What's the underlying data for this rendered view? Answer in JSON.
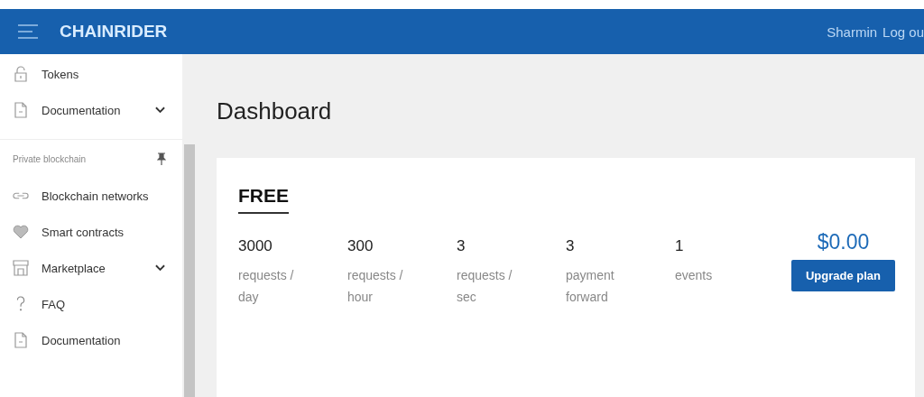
{
  "header": {
    "title": "CHAINRIDER",
    "user": "Sharmin",
    "logout": "Log ou"
  },
  "sidebar": {
    "top_items": [
      {
        "label": "Tokens",
        "expandable": false
      },
      {
        "label": "Documentation",
        "expandable": true
      }
    ],
    "section": {
      "title": "Private blockchain",
      "items": [
        {
          "label": "Blockchain networks",
          "expandable": false
        },
        {
          "label": "Smart contracts",
          "expandable": false
        },
        {
          "label": "Marketplace",
          "expandable": true
        },
        {
          "label": "FAQ",
          "expandable": false
        },
        {
          "label": "Documentation",
          "expandable": false
        }
      ]
    }
  },
  "page": {
    "title": "Dashboard"
  },
  "plan": {
    "name": "FREE",
    "stats": [
      {
        "value": "3000",
        "label": "requests / day"
      },
      {
        "value": "300",
        "label": "requests / hour"
      },
      {
        "value": "3",
        "label": "requests / sec"
      },
      {
        "value": "3",
        "label": "payment forward"
      },
      {
        "value": "1",
        "label": "events"
      }
    ],
    "price": "$0.00",
    "button": "Upgrade plan"
  }
}
